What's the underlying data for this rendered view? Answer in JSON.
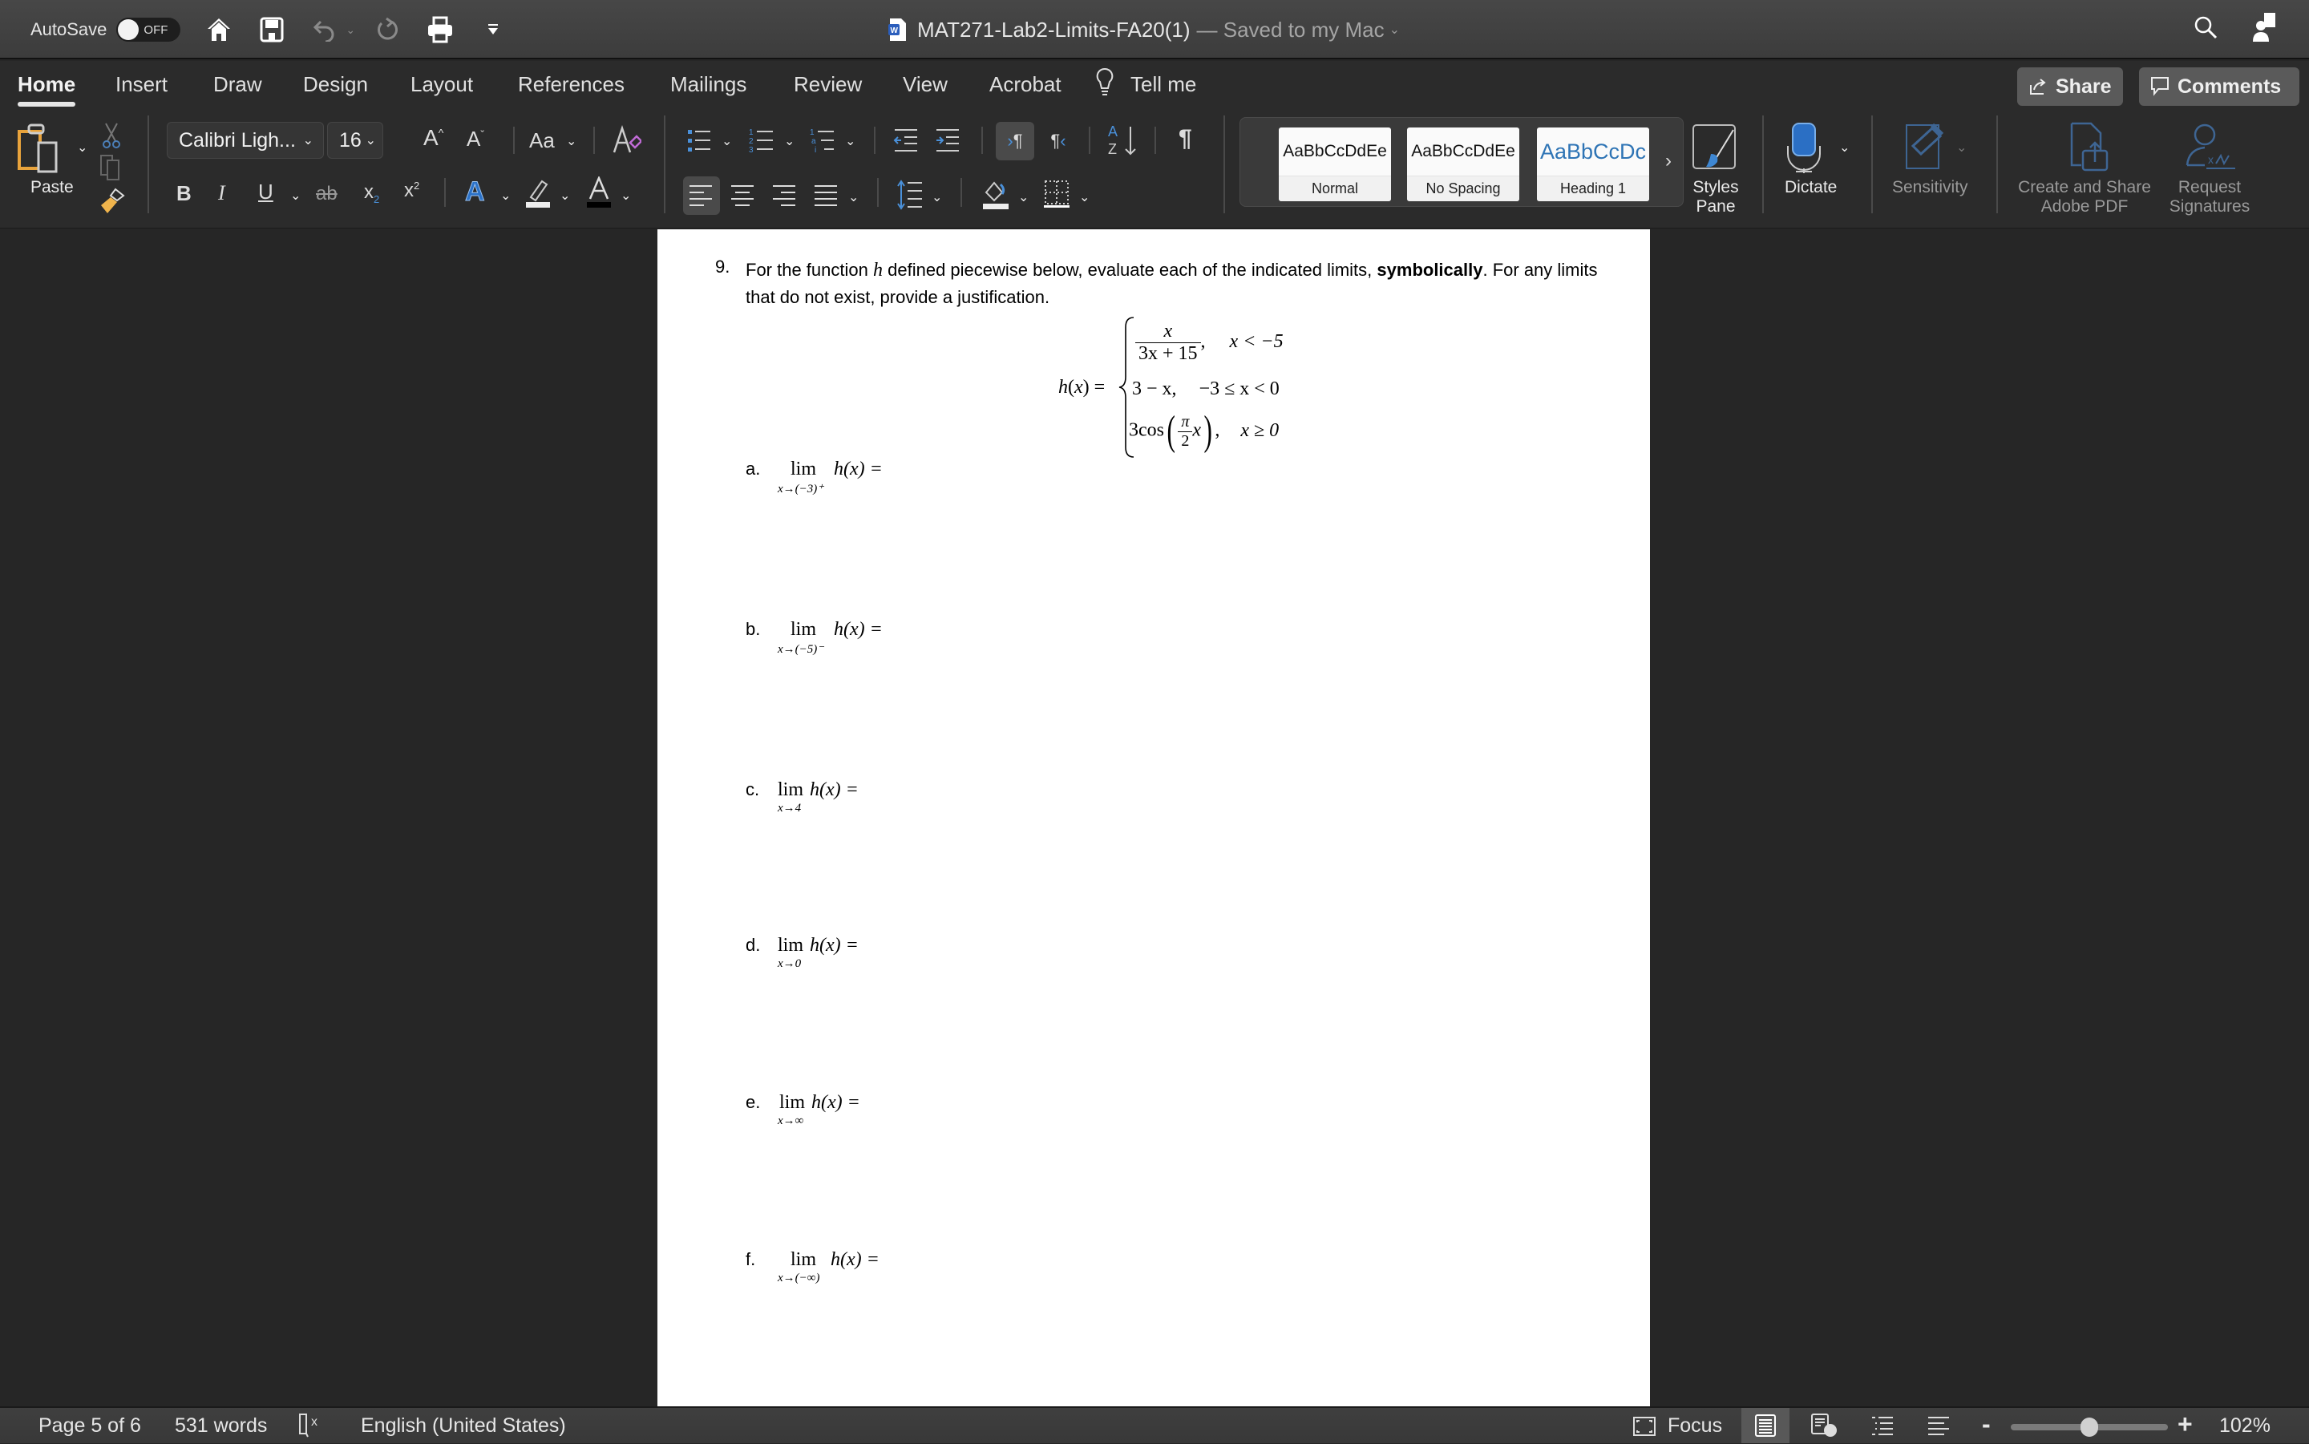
{
  "titlebar": {
    "autosave_label": "AutoSave",
    "autosave_state": "OFF",
    "doc_name": "MAT271-Lab2-Limits-FA20(1)",
    "save_status": "— Saved to my Mac",
    "icons": [
      "home-icon",
      "save-icon",
      "undo-icon",
      "redo-icon",
      "print-icon",
      "customize-toolbar-icon",
      "search-icon",
      "account-icon"
    ]
  },
  "tabs": [
    {
      "label": "Home",
      "active": true
    },
    {
      "label": "Insert"
    },
    {
      "label": "Draw"
    },
    {
      "label": "Design"
    },
    {
      "label": "Layout"
    },
    {
      "label": "References"
    },
    {
      "label": "Mailings"
    },
    {
      "label": "Review"
    },
    {
      "label": "View"
    },
    {
      "label": "Acrobat"
    },
    {
      "label": "Tell me"
    }
  ],
  "share_label": "Share",
  "comments_label": "Comments",
  "ribbon": {
    "paste_label": "Paste",
    "font_name": "Calibri Ligh...",
    "font_size": "16",
    "change_case": "Aa",
    "styles": [
      {
        "sample": "AaBbCcDdEe",
        "name": "Normal"
      },
      {
        "sample": "AaBbCcDdEe",
        "name": "No Spacing"
      },
      {
        "sample": "AaBbCcDc",
        "name": "Heading 1",
        "color": "#2e74b5"
      }
    ],
    "styles_pane_label": "Styles Pane",
    "dictate_label": "Dictate",
    "sensitivity_label": "Sensitivity",
    "create_pdf_label": "Create and Share Adobe PDF",
    "request_sig_label": "Request Signatures"
  },
  "document": {
    "question_number": "9.",
    "question_text_1": "For the function",
    "question_var": "h",
    "question_text_2": "defined piecewise below, evaluate each of the indicated limits,",
    "question_bold": "symbolically",
    "question_text_3": ". For any limits that do not exist, provide a justification.",
    "piecewise": {
      "lhs": "h(x) =",
      "cases": [
        {
          "expr_num": "x",
          "expr_den": "3x + 15",
          "condition": "x < −5"
        },
        {
          "expr": "3 − x,",
          "condition": "−3 ≤ x < 0"
        },
        {
          "expr_prefix": "3cos",
          "frac_num": "π",
          "frac_den": "2",
          "expr_suffix": "x",
          "condition": "x ≥ 0"
        }
      ]
    },
    "limits": [
      {
        "letter": "a.",
        "approach": "x→(−3)⁺",
        "rhs": "h(x) ="
      },
      {
        "letter": "b.",
        "approach": "x→(−5)⁻",
        "rhs": "h(x) ="
      },
      {
        "letter": "c.",
        "approach": "x→4",
        "rhs": "h(x) ="
      },
      {
        "letter": "d.",
        "approach": "x→0",
        "rhs": "h(x) ="
      },
      {
        "letter": "e.",
        "approach": "x→∞",
        "rhs": "h(x) ="
      },
      {
        "letter": "f.",
        "approach": "x→(−∞)",
        "rhs": "h(x) ="
      }
    ],
    "lim_word": "lim"
  },
  "statusbar": {
    "page": "Page 5 of 6",
    "words": "531 words",
    "language": "English (United States)",
    "focus_label": "Focus",
    "zoom_level": "102%",
    "zoom_fraction": 0.5
  }
}
